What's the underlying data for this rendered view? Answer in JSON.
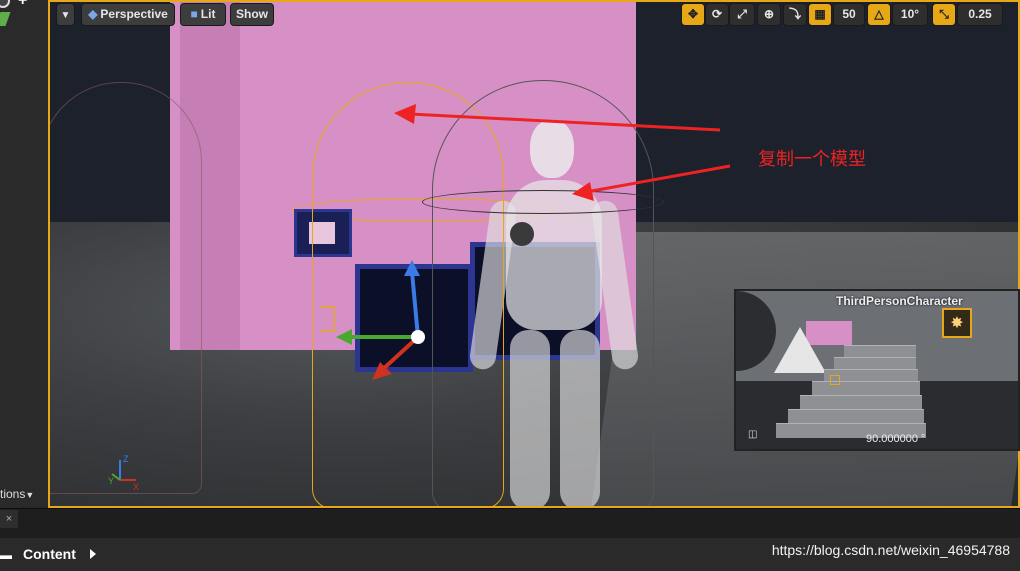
{
  "toolbar": {
    "viewport_menu_icon": "chevron-down-icon",
    "view_mode": "Perspective",
    "lighting_mode": "Lit",
    "show_label": "Show",
    "grid_snap_value": "50",
    "rotation_snap_value": "10°",
    "scale_snap_value": "0.25"
  },
  "left_panel": {
    "options_label": "tions"
  },
  "viewport": {
    "annotation_text": "复制一个模型",
    "annotation_color": "#ee2222",
    "selection_color": "#e6a817",
    "axis_labels": {
      "x": "X",
      "y": "Y",
      "z": "Z"
    }
  },
  "camera_preview": {
    "title": "ThirdPersonCharacter",
    "value": "90.000000 °"
  },
  "bottom": {
    "tab_close": "×",
    "content_label": "Content",
    "watermark": "https://blog.csdn.net/weixin_46954788"
  }
}
